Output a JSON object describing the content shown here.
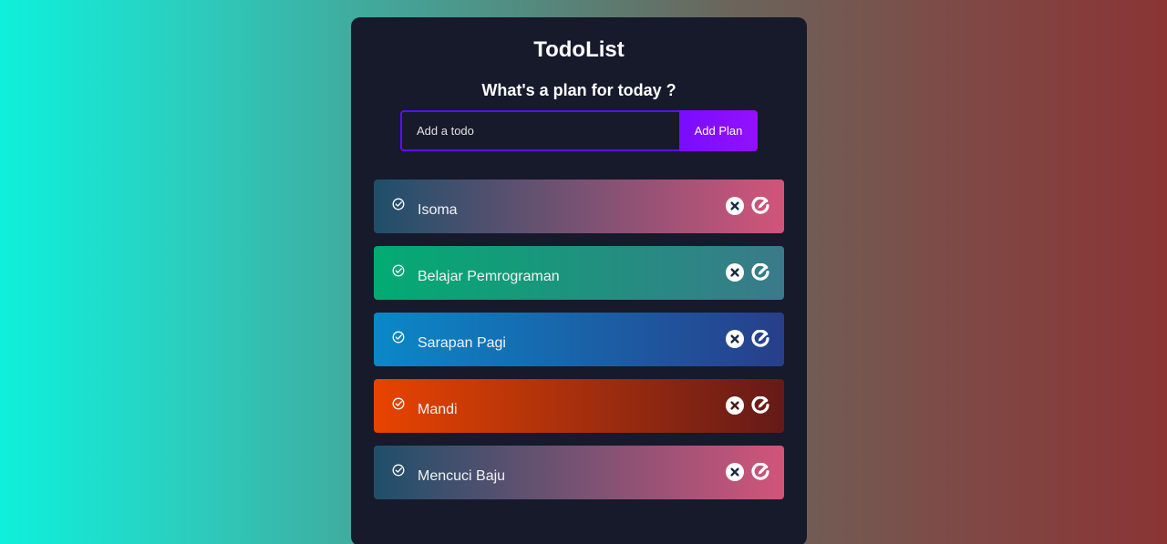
{
  "app": {
    "title": "TodoList",
    "subtitle": "What's a plan for today ?"
  },
  "form": {
    "placeholder": "Add a todo",
    "value": "",
    "add_label": "Add Plan"
  },
  "todos": [
    {
      "text": "Isoma",
      "gradient": [
        "#1e4f6a",
        "#d2547a"
      ]
    },
    {
      "text": "Belajar Pemrograman",
      "gradient": [
        "#02ab72",
        "#3a7a8a"
      ]
    },
    {
      "text": "Sarapan Pagi",
      "gradient": [
        "#0a88c8",
        "#283e8a"
      ]
    },
    {
      "text": "Mandi",
      "gradient": [
        "#e84400",
        "#641a18"
      ]
    },
    {
      "text": "Mencuci Baju",
      "gradient": [
        "#1e4f6a",
        "#d2547a"
      ]
    }
  ],
  "colors": {
    "accent": "#5d0cff",
    "card_bg": "#161a2b"
  },
  "icons": {
    "complete": "check-circle-icon",
    "delete": "close-circle-icon",
    "edit": "edit-icon"
  }
}
